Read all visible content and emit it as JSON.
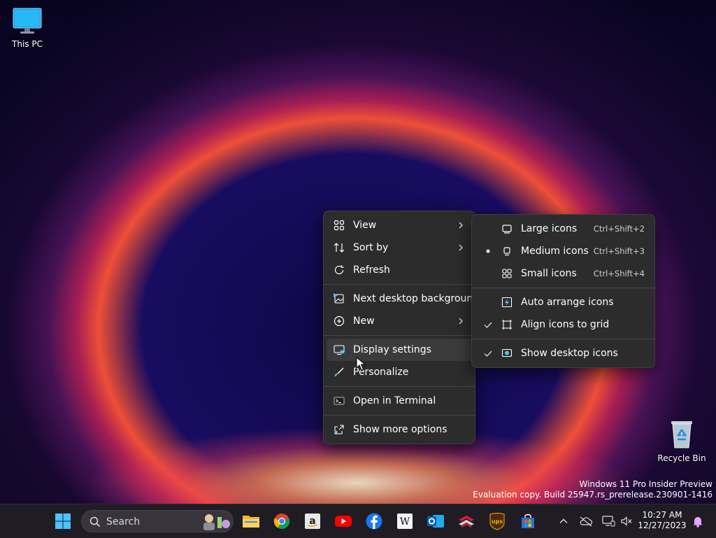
{
  "desktop": {
    "this_pc": "This PC",
    "recycle_bin": "Recycle Bin"
  },
  "context_menu": {
    "items": [
      {
        "label": "View",
        "icon": "grid-icon",
        "submenu": true
      },
      {
        "label": "Sort by",
        "icon": "sort-icon",
        "submenu": true
      },
      {
        "label": "Refresh",
        "icon": "refresh-icon"
      },
      {
        "label": "Next desktop background",
        "icon": "next-background-icon"
      },
      {
        "label": "New",
        "icon": "plus-circle-icon",
        "submenu": true
      },
      {
        "label": "Display settings",
        "icon": "display-icon"
      },
      {
        "label": "Personalize",
        "icon": "brush-icon"
      },
      {
        "label": "Open in Terminal",
        "icon": "terminal-icon"
      },
      {
        "label": "Show more options",
        "icon": "share-icon"
      }
    ],
    "hovered": "Display settings"
  },
  "view_submenu": {
    "items": [
      {
        "label": "Large icons",
        "shortcut": "Ctrl+Shift+2",
        "selected": false
      },
      {
        "label": "Medium icons",
        "shortcut": "Ctrl+Shift+3",
        "selected": true
      },
      {
        "label": "Small icons",
        "shortcut": "Ctrl+Shift+4",
        "selected": false
      },
      {
        "label": "Auto arrange icons",
        "checked": false
      },
      {
        "label": "Align icons to grid",
        "checked": true
      },
      {
        "label": "Show desktop icons",
        "checked": true
      }
    ]
  },
  "watermark": {
    "line1": "Windows 11 Pro Insider Preview",
    "line2": "Evaluation copy. Build 25947.rs_prerelease.230901-1416"
  },
  "taskbar": {
    "search_label": "Search",
    "apps": [
      "file-explorer-icon",
      "chrome-icon",
      "amazon-icon",
      "youtube-icon",
      "facebook-icon",
      "wikipedia-icon",
      "outlook-icon",
      "bank-of-america-icon",
      "ups-icon",
      "microsoft-store-icon"
    ],
    "time": "10:27 AM",
    "date": "12/27/2023"
  },
  "colors": {
    "menu_bg": "#2c2c2c",
    "accent": "#4cc2ff",
    "taskbar_bg": "#1f1c24"
  }
}
